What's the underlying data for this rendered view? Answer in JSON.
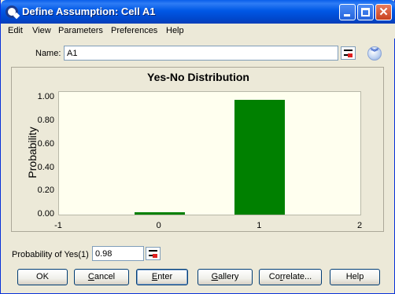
{
  "window": {
    "title": "Define Assumption: Cell A1"
  },
  "menu": [
    "Edit",
    "View",
    "Parameters",
    "Preferences",
    "Help"
  ],
  "name": {
    "label": "Name:",
    "value": "A1"
  },
  "chart_data": {
    "type": "bar",
    "title": "Yes-No Distribution",
    "ylabel": "Probability",
    "xlabel": "",
    "categories": [
      "0",
      "1"
    ],
    "x": [
      0,
      1
    ],
    "values": [
      0.02,
      0.98
    ],
    "xlim": [
      -1,
      2
    ],
    "ylim": [
      0,
      1.05
    ],
    "xticks": [
      "-1",
      "0",
      "1",
      "2"
    ],
    "yticks": [
      "1.00",
      "0.80",
      "0.60",
      "0.40",
      "0.20",
      "0.00"
    ],
    "bar_color": "#008000",
    "plot_background": "#FFFFEF"
  },
  "probability": {
    "label": "Probability of Yes(1)",
    "value": "0.98"
  },
  "buttons": {
    "ok": "OK",
    "cancel": "Cancel",
    "enter": "Enter",
    "gallery": "Gallery",
    "correlate": "Correlate...",
    "help": "Help"
  }
}
